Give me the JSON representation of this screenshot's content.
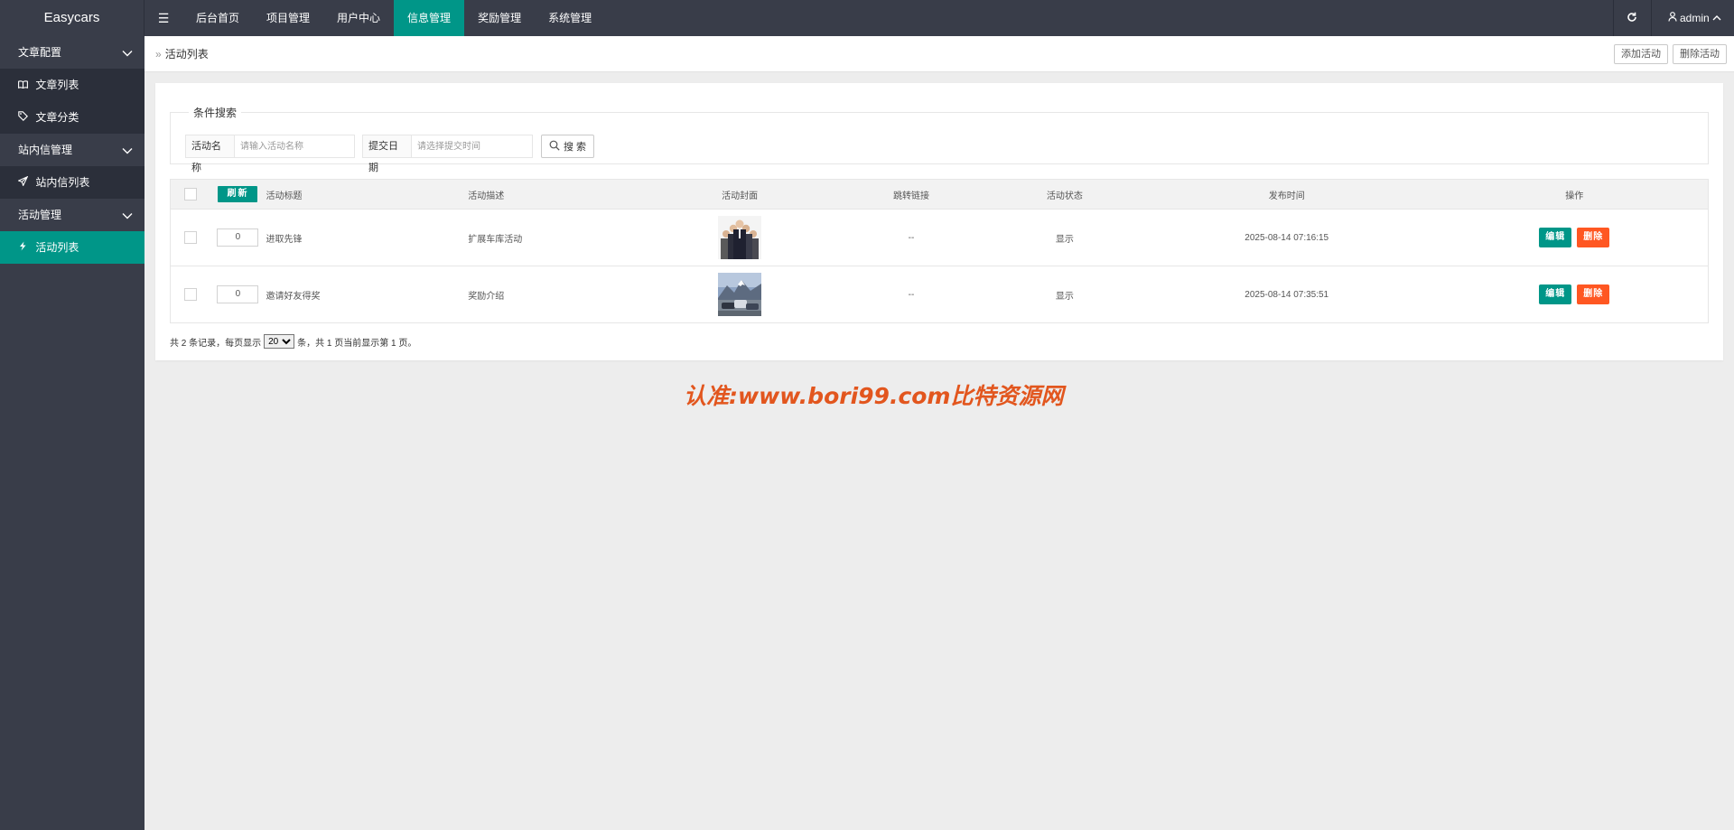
{
  "app": {
    "title": "Easycars"
  },
  "topnav": {
    "menu_toggle": "☰",
    "items": [
      "后台首页",
      "项目管理",
      "用户中心",
      "信息管理",
      "奖励管理",
      "系统管理"
    ],
    "active_index": 3
  },
  "topright": {
    "refresh_icon": "refresh-icon",
    "user": "admin",
    "user_icon": "user-icon",
    "user_chevron": "^"
  },
  "sidebar": {
    "groups": [
      {
        "label": "文章配置",
        "items": [
          {
            "icon": "book-icon",
            "label": "文章列表"
          },
          {
            "icon": "tag-icon",
            "label": "文章分类"
          }
        ]
      },
      {
        "label": "站内信管理",
        "items": [
          {
            "icon": "send-icon",
            "label": "站内信列表"
          }
        ]
      },
      {
        "label": "活动管理",
        "items": [
          {
            "icon": "activity-icon",
            "label": "活动列表"
          }
        ]
      }
    ],
    "active_item": "活动列表"
  },
  "breadcrumb": {
    "sep": "»",
    "current": "活动列表"
  },
  "toolbar": {
    "add": "添加活动",
    "delete": "删除活动"
  },
  "search": {
    "legend": "条件搜索",
    "name_label": "活动名称",
    "name_placeholder": "请输入活动名称",
    "date_label": "提交日期",
    "date_placeholder": "请选择提交时间",
    "button": "搜 索"
  },
  "table": {
    "refresh_btn": "刷新",
    "headers": [
      "活动标题",
      "活动描述",
      "活动封面",
      "跳转链接",
      "活动状态",
      "发布时间",
      "操作"
    ],
    "rows": [
      {
        "sort": "0",
        "title": "进取先锋",
        "desc": "扩展车库活动",
        "cover": "business-team-image",
        "link": "--",
        "status": "显示",
        "time": "2025-08-14 07:16:15"
      },
      {
        "sort": "0",
        "title": "邀请好友得奖",
        "desc": "奖励介绍",
        "cover": "mountain-cars-image",
        "link": "--",
        "status": "显示",
        "time": "2025-08-14 07:35:51"
      }
    ],
    "edit": "编辑",
    "del": "删除"
  },
  "pager": {
    "prefix": "共 2 条记录，每页显示",
    "page_size": "20",
    "suffix": "条，共 1 页当前显示第 1 页。"
  },
  "colors": {
    "topbar": "#393d49",
    "accent": "#009688",
    "danger": "#ff5722",
    "status": "#1e9e1e",
    "watermark": "#e2561e"
  },
  "watermark": "认准:www.bori99.com比特资源网"
}
